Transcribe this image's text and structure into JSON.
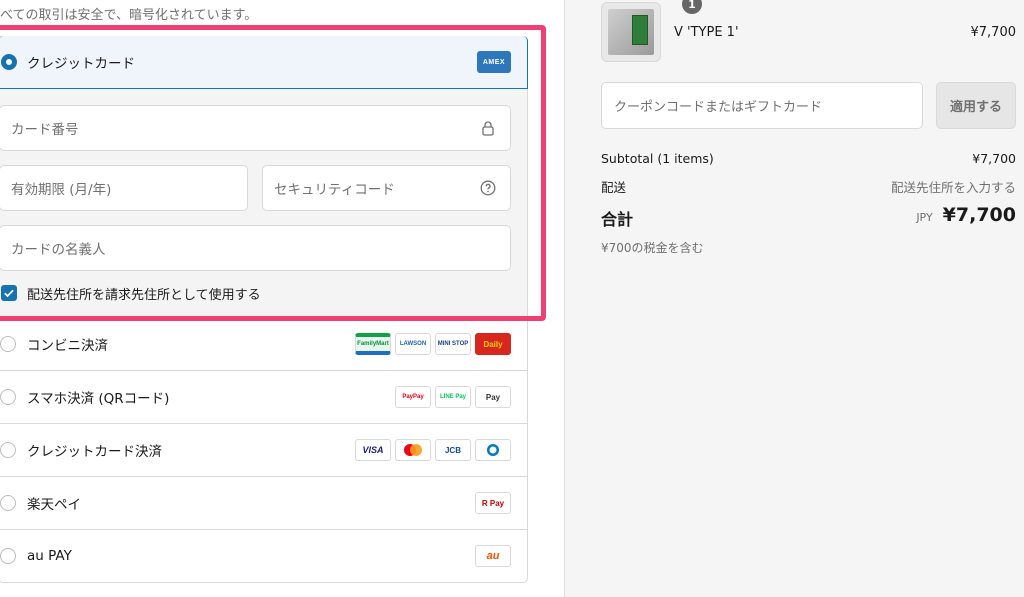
{
  "secure_note": "べての取引は安全で、暗号化されています。",
  "payment": {
    "credit_card": {
      "label": "クレジットカード",
      "badge": "AMEX",
      "card_number_placeholder": "カード番号",
      "expiry_placeholder": "有効期限 (月/年)",
      "security_code_placeholder": "セキュリティコード",
      "name_placeholder": "カードの名義人",
      "same_address_label": "配送先住所を請求先住所として使用する",
      "same_address_checked": true
    },
    "methods": [
      {
        "label": "コンビニ決済",
        "logos": [
          "FamilyMart",
          "LAWSON",
          "MINI STOP",
          "Daily"
        ]
      },
      {
        "label": "スマホ決済 (QRコード)",
        "logos": [
          "PayPay",
          "LINE Pay",
          "Pay"
        ]
      },
      {
        "label": "クレジットカード決済",
        "logos": [
          "VISA",
          "",
          "JCB",
          ""
        ]
      },
      {
        "label": "楽天ペイ",
        "logos": [
          "R Pay"
        ]
      },
      {
        "label": "au PAY",
        "logos": [
          "au"
        ]
      }
    ]
  },
  "cart": {
    "item_qty": "1",
    "item_name": "V 'TYPE 1'",
    "item_price": "¥7,700",
    "coupon_placeholder": "クーポンコードまたはギフトカード",
    "apply_label": "適用する",
    "subtotal_label": "Subtotal (1 items)",
    "subtotal_value": "¥7,700",
    "shipping_label": "配送",
    "shipping_value": "配送先住所を入力する",
    "total_label": "合計",
    "total_currency": "JPY",
    "total_value": "¥7,700",
    "tax_note": "¥700の税金を含む"
  },
  "colors": {
    "accent": "#1773b0",
    "highlight": "#f03f73"
  }
}
